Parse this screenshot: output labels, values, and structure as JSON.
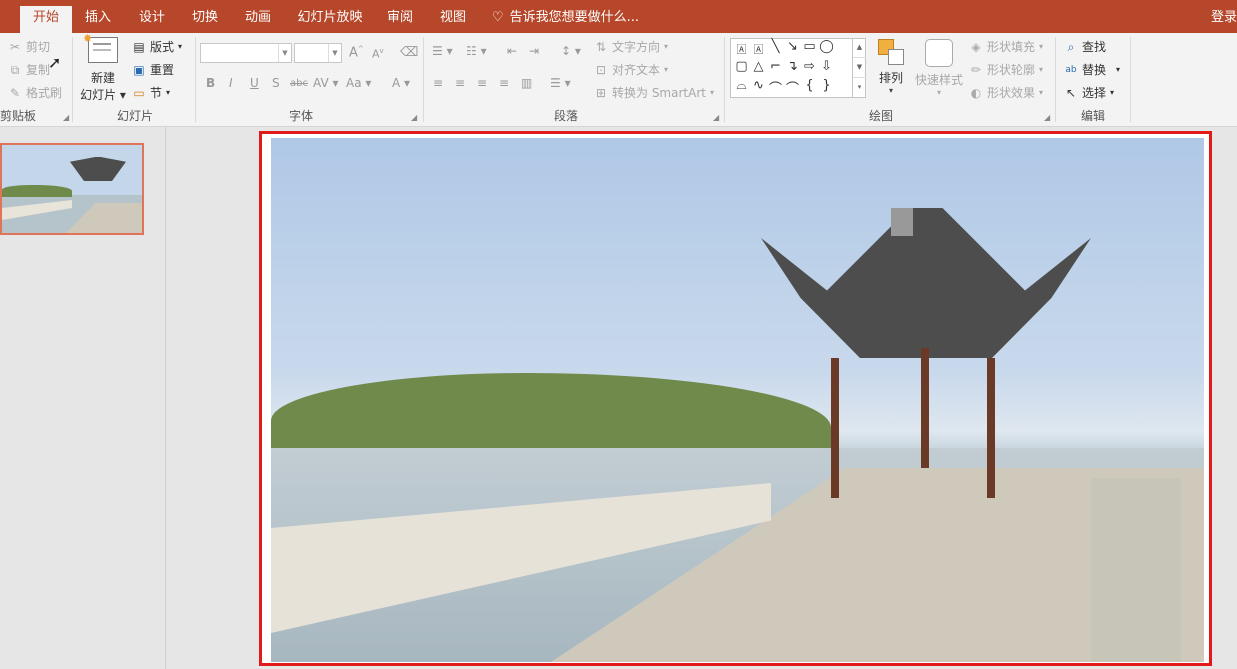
{
  "tabs": [
    {
      "label": "开始",
      "active": true
    },
    {
      "label": "插入"
    },
    {
      "label": "设计"
    },
    {
      "label": "切换"
    },
    {
      "label": "动画"
    },
    {
      "label": "幻灯片放映"
    },
    {
      "label": "审阅"
    },
    {
      "label": "视图"
    }
  ],
  "tell_me": "告诉我您想要做什么...",
  "login": "登录",
  "clipboard": {
    "cut": "剪切",
    "copy": "复制",
    "painter": "格式刷",
    "label": "剪贴板"
  },
  "slides": {
    "new_line1": "新建",
    "new_line2": "幻灯片",
    "layout": "版式",
    "reset": "重置",
    "section": "节",
    "label": "幻灯片"
  },
  "font": {
    "label": "字体",
    "bold": "B",
    "italic": "I",
    "underline": "U",
    "shadow": "S",
    "strike": "abc",
    "spacing": "AV",
    "case": "Aa",
    "color": "A",
    "grow": "A",
    "shrink": "A"
  },
  "paragraph": {
    "text_direction": "文字方向",
    "align_text": "对齐文本",
    "smartart": "转换为 SmartArt",
    "label": "段落"
  },
  "drawing": {
    "arrange": "排列",
    "quick_styles": "快速样式",
    "fill": "形状填充",
    "outline": "形状轮廓",
    "effects": "形状效果",
    "label": "绘图"
  },
  "editing": {
    "find": "查找",
    "replace": "替换",
    "select": "选择",
    "label": "编辑"
  },
  "colors": {
    "accent": "#b7472a",
    "selection": "#e21a1a"
  }
}
